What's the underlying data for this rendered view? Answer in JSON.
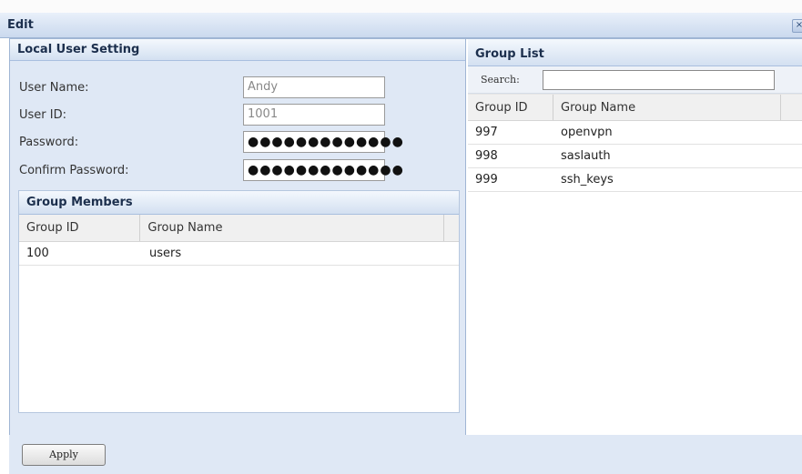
{
  "dialog": {
    "title": "Edit",
    "close_glyph": "×"
  },
  "local_user": {
    "section_title": "Local User Setting",
    "fields": [
      {
        "label": "User Name:",
        "value": "Andy"
      },
      {
        "label": "User ID:",
        "value": "1001"
      },
      {
        "label": "Password:",
        "value": "●●●●●●●●●●●●●"
      },
      {
        "label": "Confirm Password:",
        "value": "●●●●●●●●●●●●●"
      }
    ]
  },
  "group_members": {
    "title": "Group Members",
    "columns": [
      "Group ID",
      "Group Name"
    ],
    "rows": [
      {
        "id": "100",
        "name": "users"
      }
    ]
  },
  "group_list": {
    "title": "Group List",
    "search_label": "Search:",
    "search_value": "",
    "columns": [
      "Group ID",
      "Group Name"
    ],
    "rows": [
      {
        "id": "997",
        "name": "openvpn"
      },
      {
        "id": "998",
        "name": "saslauth"
      },
      {
        "id": "999",
        "name": "ssh_keys"
      }
    ]
  },
  "footer": {
    "apply_label": "Apply"
  },
  "colors": {
    "panel_bg": "#dfe8f5",
    "header_text": "#1c2f4d",
    "border": "#9fb5d4"
  }
}
